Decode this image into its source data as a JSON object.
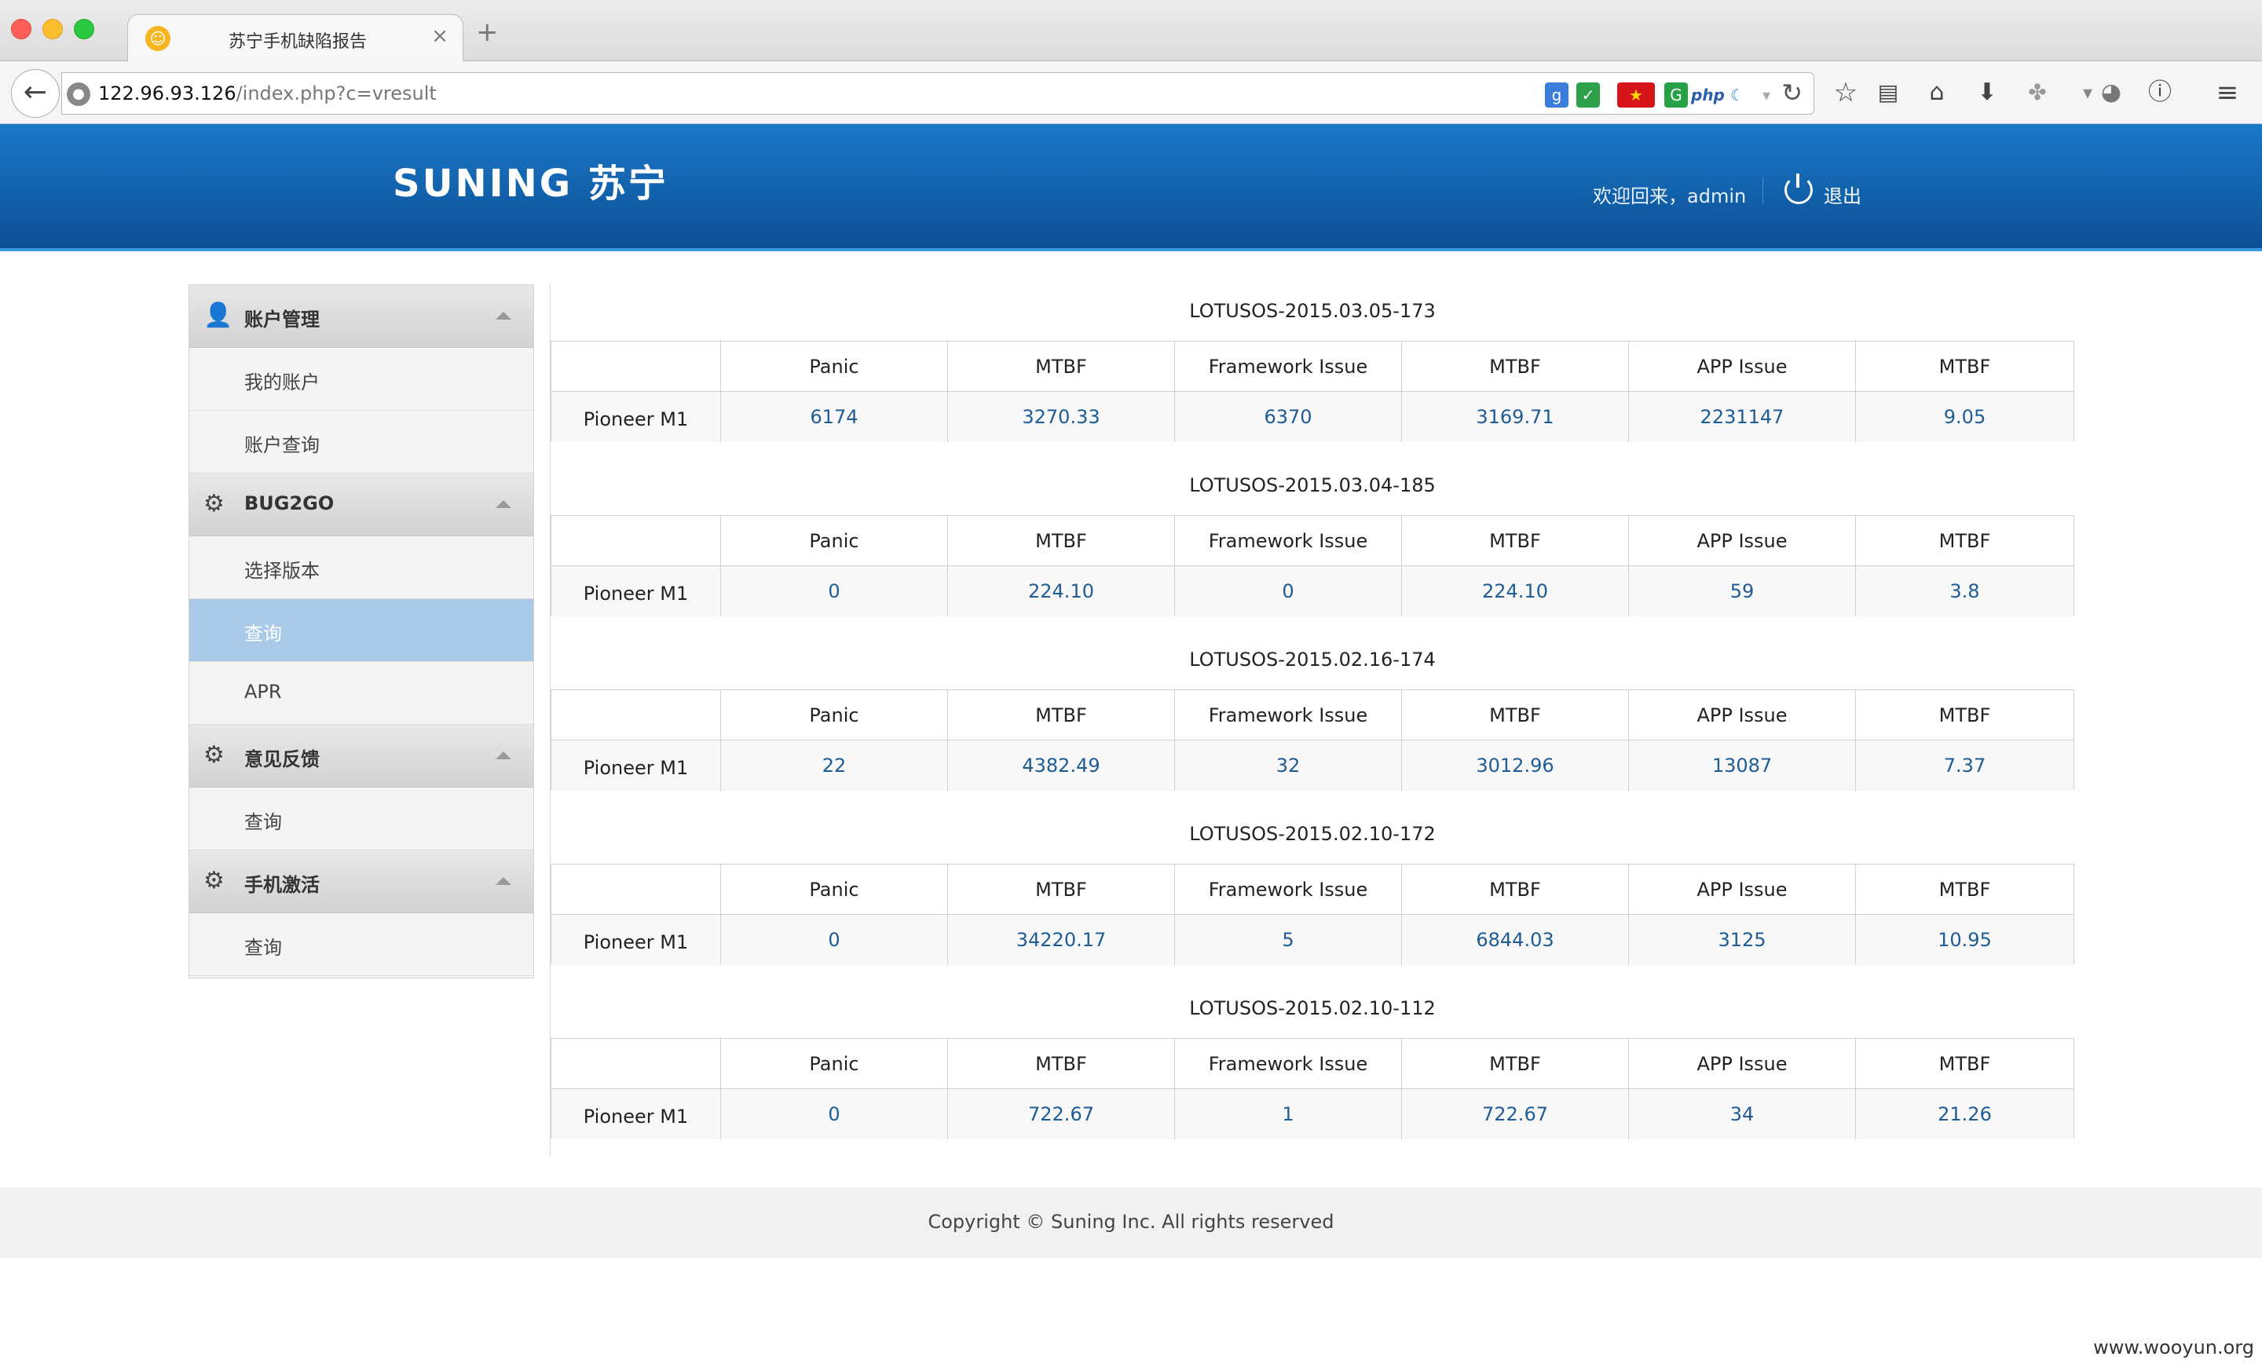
{
  "browser": {
    "tab_title": "苏宁手机缺陷报告",
    "tab_close": "×",
    "new_tab": "+",
    "url_host": "122.96.93.126",
    "url_path": "/index.php?c=vresult",
    "back": "←",
    "reload": "↻",
    "ext_php": "php",
    "toolbar_icons": [
      "bookmark-star-icon",
      "reader-icon",
      "home-icon",
      "download-icon",
      "addon-icon",
      "globe-icon",
      "info-icon",
      "menu-icon"
    ]
  },
  "header": {
    "logo": "SUNING 苏宁",
    "welcome": "欢迎回来，admin",
    "logout": "退出"
  },
  "sidebar": {
    "groups": [
      {
        "label": "账户管理",
        "icon": "users-icon",
        "items": [
          {
            "label": "我的账户"
          },
          {
            "label": "账户查询"
          }
        ]
      },
      {
        "label": "BUG2GO",
        "icon": "gear-icon",
        "items": [
          {
            "label": "选择版本"
          },
          {
            "label": "查询",
            "active": true
          },
          {
            "label": "APR"
          }
        ]
      },
      {
        "label": "意见反馈",
        "icon": "gear-icon",
        "items": [
          {
            "label": "查询"
          }
        ]
      },
      {
        "label": "手机激活",
        "icon": "gear-icon",
        "items": [
          {
            "label": "查询"
          }
        ]
      }
    ]
  },
  "reports": {
    "columns": [
      "",
      "Panic",
      "MTBF",
      "Framework Issue",
      "MTBF",
      "APP Issue",
      "MTBF"
    ],
    "items": [
      {
        "title": "LOTUSOS-2015.03.05-173",
        "row": [
          "Pioneer M1",
          "6174",
          "3270.33",
          "6370",
          "3169.71",
          "2231147",
          "9.05"
        ]
      },
      {
        "title": "LOTUSOS-2015.03.04-185",
        "row": [
          "Pioneer M1",
          "0",
          "224.10",
          "0",
          "224.10",
          "59",
          "3.8"
        ]
      },
      {
        "title": "LOTUSOS-2015.02.16-174",
        "row": [
          "Pioneer M1",
          "22",
          "4382.49",
          "32",
          "3012.96",
          "13087",
          "7.37"
        ]
      },
      {
        "title": "LOTUSOS-2015.02.10-172",
        "row": [
          "Pioneer M1",
          "0",
          "34220.17",
          "5",
          "6844.03",
          "3125",
          "10.95"
        ]
      },
      {
        "title": "LOTUSOS-2015.02.10-112",
        "row": [
          "Pioneer M1",
          "0",
          "722.67",
          "1",
          "722.67",
          "34",
          "21.26"
        ]
      }
    ]
  },
  "footer": {
    "copyright": "Copyright © Suning Inc. All rights reserved"
  },
  "watermark": "www.wooyun.org",
  "colors": {
    "header_blue": "#1565b4",
    "active_item": "#a9c9e8",
    "value_text": "#1e5c96"
  }
}
